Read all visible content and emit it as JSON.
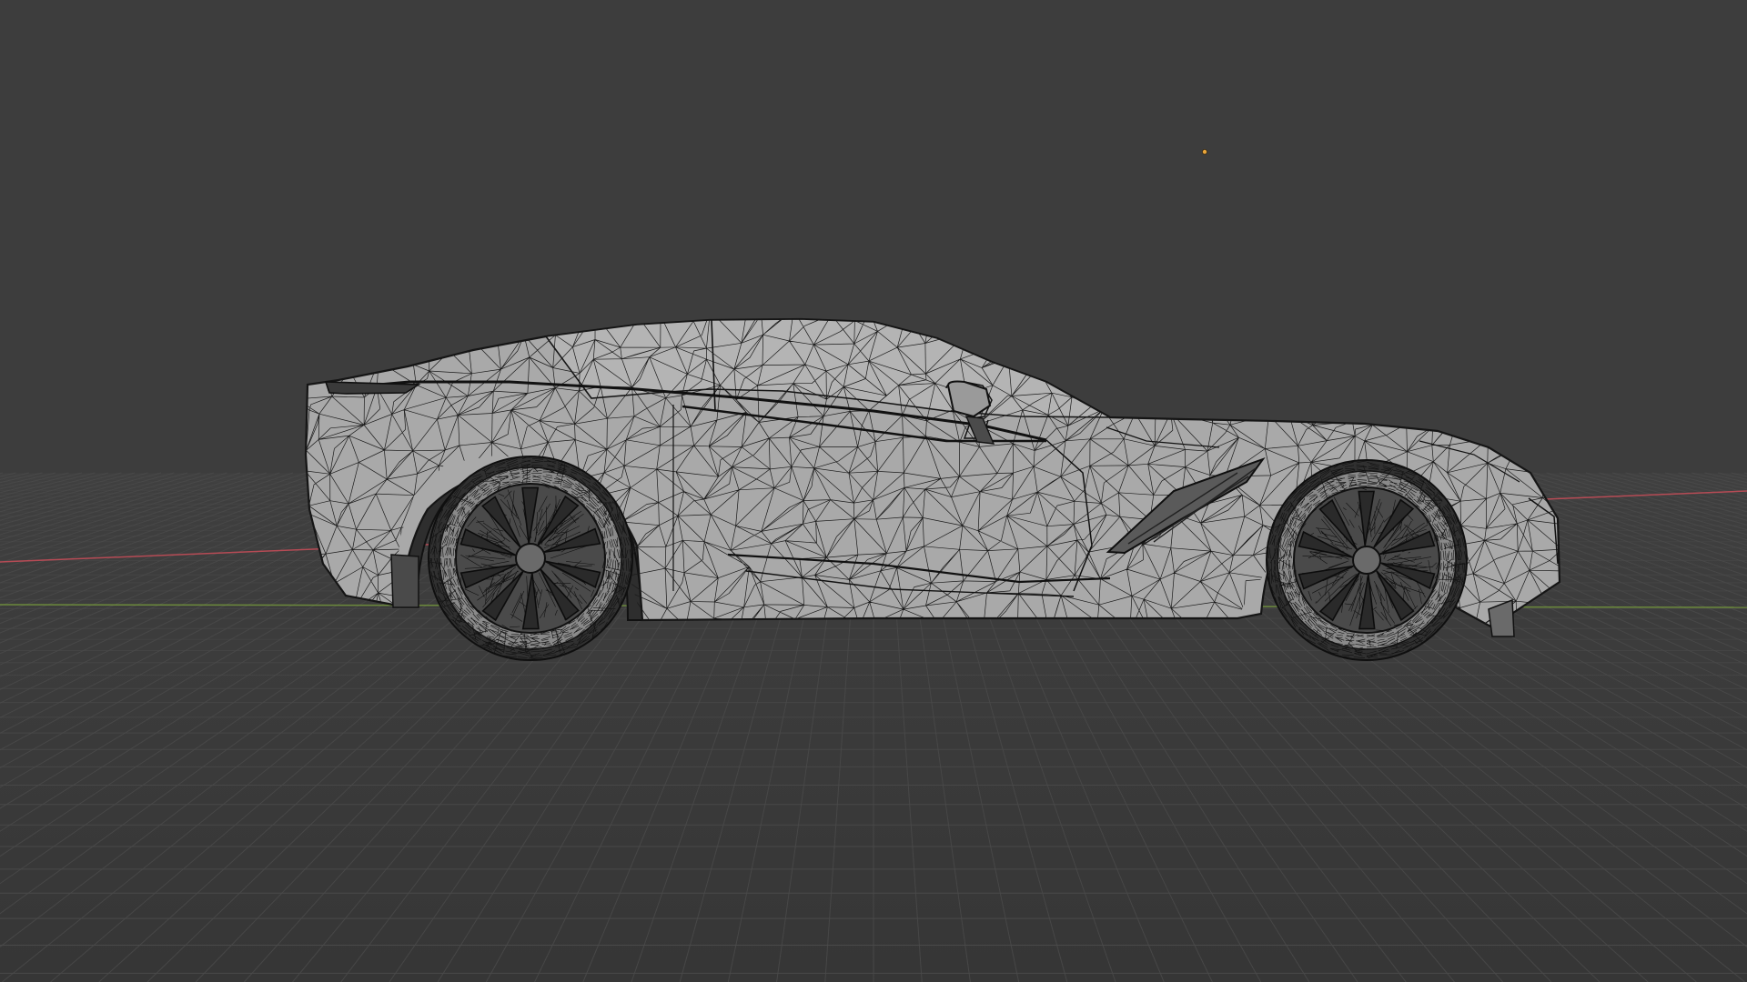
{
  "viewport": {
    "view": "side",
    "shading": "wireframe-over-solid",
    "background_color": "#3d3d3d",
    "grid_color": "#4a4a4a",
    "x_axis_color": "#b64b55",
    "y_axis_color": "#6c8a3c",
    "origin_marker_color": "#e9a53a",
    "mesh_fill_color": "#a9a9a9",
    "wire_color": "#1a1a1a",
    "tire_color": "#2b2b2b"
  },
  "objects": [
    {
      "name": "car-body-mesh",
      "icon": "car-mesh"
    },
    {
      "name": "rear-wheel-mesh",
      "icon": "wheel-mesh"
    },
    {
      "name": "front-wheel-mesh",
      "icon": "wheel-mesh"
    },
    {
      "name": "side-mirror-mesh",
      "icon": "mirror-mesh"
    },
    {
      "name": "light-origin",
      "icon": "light-dot"
    }
  ]
}
